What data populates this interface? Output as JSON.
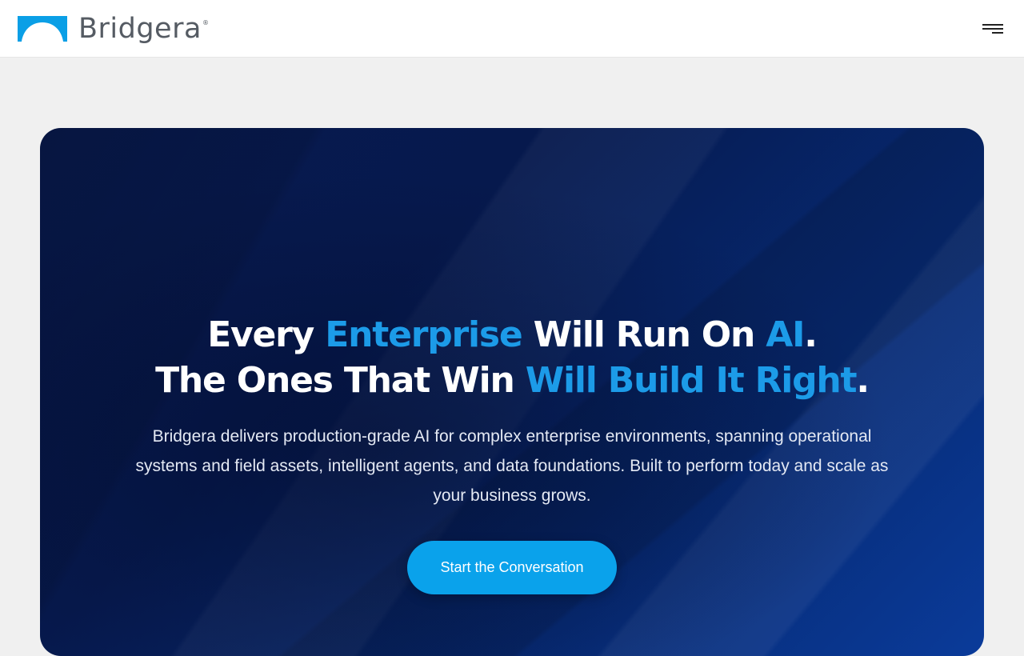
{
  "header": {
    "brand_name": "Bridgera",
    "brand_trademark": "®",
    "menu_icon": "hamburger-menu-icon"
  },
  "hero": {
    "headline": {
      "line1": {
        "part1": "Every ",
        "accent1": "Enterprise",
        "part2": " Will Run On ",
        "accent2": "AI",
        "part3": "."
      },
      "line2": {
        "part1": "The Ones That Win ",
        "accent1": "Will Build It Right",
        "part2": "."
      }
    },
    "description": "Bridgera delivers production-grade AI for complex enterprise environments, spanning operational systems and field assets, intelligent agents, and data foundations. Built to perform today and scale as your business grows.",
    "cta_label": "Start the Conversation"
  },
  "colors": {
    "accent_blue": "#1c9be8",
    "cta_blue": "#0aa2eb",
    "hero_navy": "#06194d",
    "page_background": "#f0f0f0",
    "logo_text": "#555b63"
  }
}
